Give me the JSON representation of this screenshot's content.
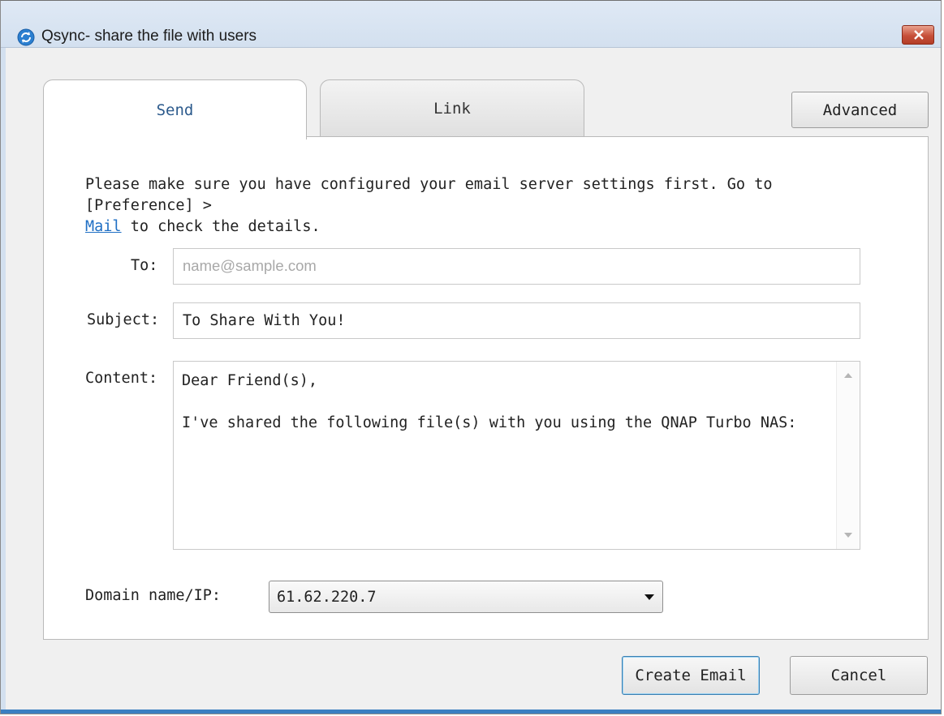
{
  "window": {
    "title": "Qsync- share the file with users"
  },
  "tabs": [
    {
      "label": "Send",
      "active": true
    },
    {
      "label": "Link",
      "active": false
    }
  ],
  "toolbar": {
    "advanced_label": "Advanced"
  },
  "notice": {
    "text_before": "Please make sure you have configured your email server settings first. Go to [Preference] >",
    "link_label": "Mail",
    "text_after": " to check the details."
  },
  "form": {
    "to_label": "To:",
    "to_placeholder": "name@sample.com",
    "to_value": "",
    "subject_label": "Subject:",
    "subject_value": "To Share With You!",
    "content_label": "Content:",
    "content_lines": [
      "Dear Friend(s),",
      "",
      "I've shared the following file(s) with you using the QNAP Turbo NAS:"
    ],
    "domain_label": "Domain name/IP:",
    "domain_value": "61.62.220.7"
  },
  "footer": {
    "create_label": "Create Email",
    "cancel_label": "Cancel"
  },
  "colors": {
    "link": "#1f6fc4",
    "active_tab_text": "#2c5a8c",
    "close_button": "#c7503a"
  },
  "icons": {
    "app": "qsync-sync-icon",
    "close": "close-x-icon",
    "scroll_up": "scroll-up-arrow-icon",
    "scroll_down": "scroll-down-arrow-icon",
    "dropdown": "chevron-down-icon"
  }
}
